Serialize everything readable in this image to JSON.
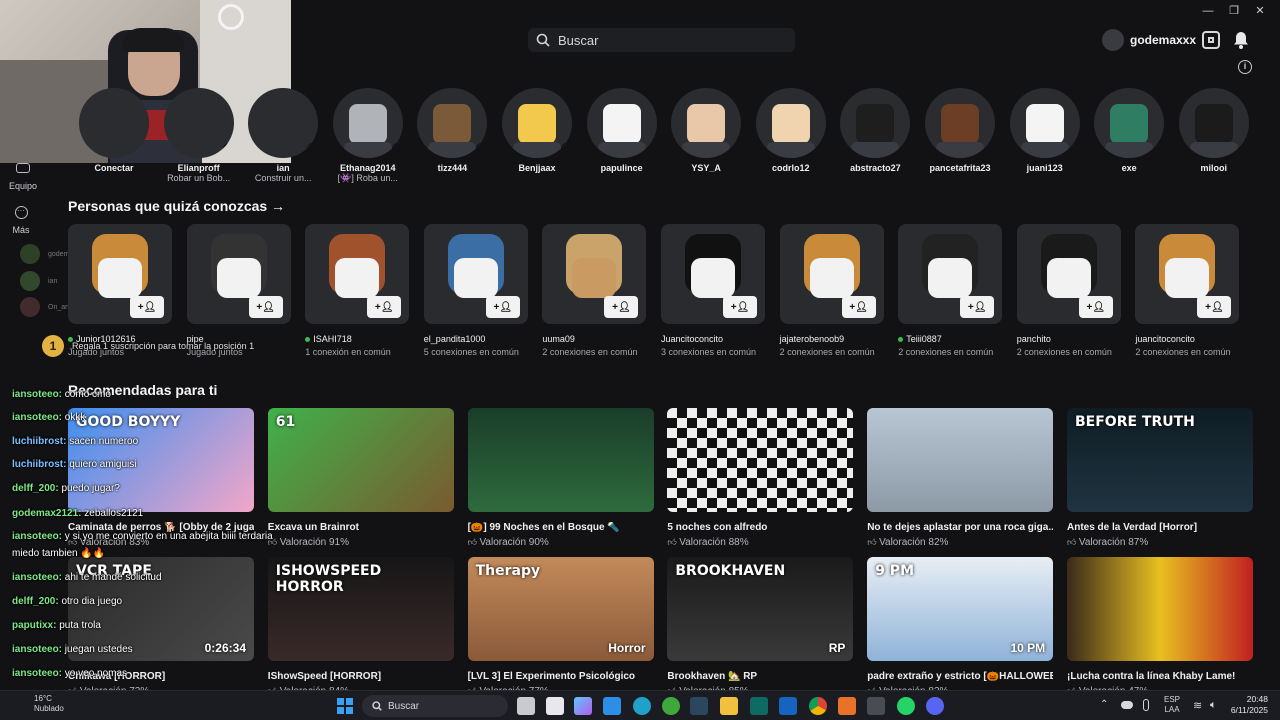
{
  "search": {
    "placeholder": "Buscar"
  },
  "user": {
    "name": "godemaxxx"
  },
  "sidebar": {
    "team_label": "Equipo",
    "more_label": "Más",
    "mini": [
      "godemax",
      "ian",
      "On_ana2.0"
    ]
  },
  "friends": [
    {
      "name": "Conectar",
      "status": ""
    },
    {
      "name": "Elianproff",
      "status": "Robar un Bob..."
    },
    {
      "name": "ian",
      "status": "Construir un..."
    },
    {
      "name": "Ethanag2014",
      "status": "[👾] Roba un..."
    },
    {
      "name": "tizz444",
      "status": ""
    },
    {
      "name": "Benjjaax",
      "status": ""
    },
    {
      "name": "papulince",
      "status": ""
    },
    {
      "name": "YSY_A",
      "status": ""
    },
    {
      "name": "codrlo12",
      "status": ""
    },
    {
      "name": "abstracto27",
      "status": ""
    },
    {
      "name": "pancetafrita23",
      "status": ""
    },
    {
      "name": "juani123",
      "status": ""
    },
    {
      "name": "exe",
      "status": ""
    },
    {
      "name": "milooi",
      "status": ""
    }
  ],
  "people_title": "Personas que quizá conozcas →",
  "people": [
    {
      "name": "Junior1012616",
      "conn": "Jugado juntos",
      "online": true
    },
    {
      "name": "pipe",
      "conn": "Jugado juntos",
      "online": false
    },
    {
      "name": "ISAHI718",
      "conn": "1 conexión en común",
      "online": true
    },
    {
      "name": "el_pandita1000",
      "conn": "5 conexiones en común",
      "online": false
    },
    {
      "name": "uuma09",
      "conn": "2 conexiones en común",
      "online": false
    },
    {
      "name": "Juancitoconcito",
      "conn": "3 conexiones en común",
      "online": false
    },
    {
      "name": "jajaterobenoob9",
      "conn": "2 conexiones en común",
      "online": false
    },
    {
      "name": "Teiii0887",
      "conn": "2 conexiones en común",
      "online": true
    },
    {
      "name": "panchito",
      "conn": "2 conexiones en común",
      "online": false
    },
    {
      "name": "juancitoconcito",
      "conn": "2 conexiones en común",
      "online": false
    }
  ],
  "subs_notice": {
    "rank": "1",
    "text": "Regala 1 suscripción para tomar la posición 1"
  },
  "recommended_title": "Recomendadas para ti",
  "games_row1": [
    {
      "title": "Caminata de perros 🐕 [Obby de 2 juga...",
      "rating": "Valoración 83%",
      "thumb_text": "GOOD BOYYY"
    },
    {
      "title": "Excava un Brainrot",
      "rating": "Valoración 91%",
      "thumb_text": "61"
    },
    {
      "title": "[🎃] 99 Noches en el Bosque 🔦",
      "rating": "Valoración 90%",
      "thumb_text": ""
    },
    {
      "title": "5 noches con alfredo",
      "rating": "Valoración 88%",
      "thumb_text": ""
    },
    {
      "title": "No te dejes aplastar por una roca giga...",
      "rating": "Valoración 82%",
      "thumb_text": ""
    },
    {
      "title": "Antes de la Verdad [Horror]",
      "rating": "Valoración 87%",
      "thumb_text": "BEFORE TRUTH"
    }
  ],
  "games_row2": [
    {
      "title": "Chilkawa [HORROR]",
      "rating": "Valoración 72%",
      "thumb_text": "VCR TAPE",
      "extra": "0:26:34"
    },
    {
      "title": "IShowSpeed [HORROR]",
      "rating": "Valoración 84%",
      "thumb_text": "ISHOWSPEED HORROR",
      "extra": ""
    },
    {
      "title": "[LVL 3] El Experimento Psicológico",
      "rating": "Valoración 77%",
      "thumb_text": "Therapy",
      "extra": "Horror"
    },
    {
      "title": "Brookhaven 🏡 RP",
      "rating": "Valoración 85%",
      "thumb_text": "BROOKHAVEN",
      "extra": "RP"
    },
    {
      "title": "padre extraño y estricto [🎃HALLOWEE...",
      "rating": "Valoración 82%",
      "thumb_text": "9 PM",
      "extra": "10 PM"
    },
    {
      "title": "¡Lucha contra la línea Khaby Lame!",
      "rating": "Valoración 47%",
      "thumb_text": "",
      "extra": ""
    }
  ],
  "chat": [
    {
      "user": "iansoteeo:",
      "msg": "como cmo"
    },
    {
      "user": "iansoteeo:",
      "msg": "okkk"
    },
    {
      "user": "luchiibrost:",
      "msg": "sacen numeroo"
    },
    {
      "user": "luchiibrost:",
      "msg": "quiero amiguisi"
    },
    {
      "user": "delff_200:",
      "msg": "puedo jugar?"
    },
    {
      "user": "godemax2121:",
      "msg": "zeballos2121"
    },
    {
      "user": "iansoteeo:",
      "msg": "y si yo me convierto en una abejita biiii terdaria"
    },
    {
      "user": "",
      "msg": "miedo tambien 🔥🔥"
    },
    {
      "user": "iansoteeo:",
      "msg": "ahi te mandé solicitud"
    },
    {
      "user": "delff_200:",
      "msg": "otro dia juego"
    },
    {
      "user": "paputixx:",
      "msg": "puta trola"
    },
    {
      "user": "iansoteeo:",
      "msg": "juegan ustedes"
    },
    {
      "user": "iansoteeo:",
      "msg": "yo veo nomas"
    },
    {
      "user": "paputixx:",
      "msg": "xd"
    }
  ],
  "taskbar": {
    "weather_temp": "16°C",
    "weather_desc": "Nublado",
    "search_label": "Buscar",
    "lang1": "ESP",
    "lang2": "LAA",
    "time": "20:48",
    "date": "6/11/2025"
  },
  "colors": {
    "bg": "#121215",
    "online": "#3fb950",
    "accent": "#1f6feb"
  }
}
